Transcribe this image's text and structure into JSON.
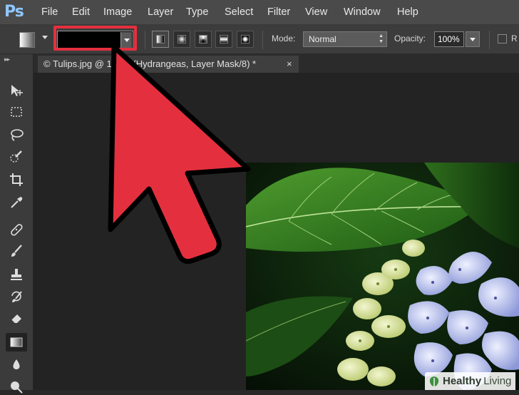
{
  "menubar": {
    "logo": "Ps",
    "items": [
      "File",
      "Edit",
      "Image",
      "Layer",
      "Type",
      "Select",
      "Filter",
      "View",
      "Window",
      "Help"
    ]
  },
  "options": {
    "mode_label": "Mode:",
    "mode_value": "Normal",
    "opacity_label": "Opacity:",
    "opacity_value": "100%",
    "reverse_label": "R"
  },
  "document": {
    "tab_title": "© Tulips.jpg @ 100% (Hydrangeas, Layer Mask/8) *",
    "close_glyph": "×"
  },
  "tools": [
    {
      "name": "move-tool",
      "icon": "move-icon"
    },
    {
      "name": "marquee-tool",
      "icon": "marquee-icon"
    },
    {
      "name": "lasso-tool",
      "icon": "lasso-icon"
    },
    {
      "name": "quick-selection-tool",
      "icon": "quick-selection-icon"
    },
    {
      "name": "crop-tool",
      "icon": "crop-icon"
    },
    {
      "name": "eyedropper-tool",
      "icon": "eyedropper-icon"
    },
    {
      "name": "healing-brush-tool",
      "icon": "bandage-icon"
    },
    {
      "name": "brush-tool",
      "icon": "brush-icon"
    },
    {
      "name": "clone-stamp-tool",
      "icon": "stamp-icon"
    },
    {
      "name": "history-brush-tool",
      "icon": "history-brush-icon"
    },
    {
      "name": "eraser-tool",
      "icon": "eraser-icon"
    },
    {
      "name": "gradient-tool",
      "icon": "gradient-icon",
      "active": true
    },
    {
      "name": "blur-tool",
      "icon": "blur-icon"
    },
    {
      "name": "dodge-tool",
      "icon": "dodge-icon"
    }
  ],
  "colors": {
    "highlight": "#e4303e",
    "ps_blue": "#8fc7ff"
  },
  "watermark": {
    "brand_part1": "Healthy",
    "brand_part2": " Living"
  }
}
